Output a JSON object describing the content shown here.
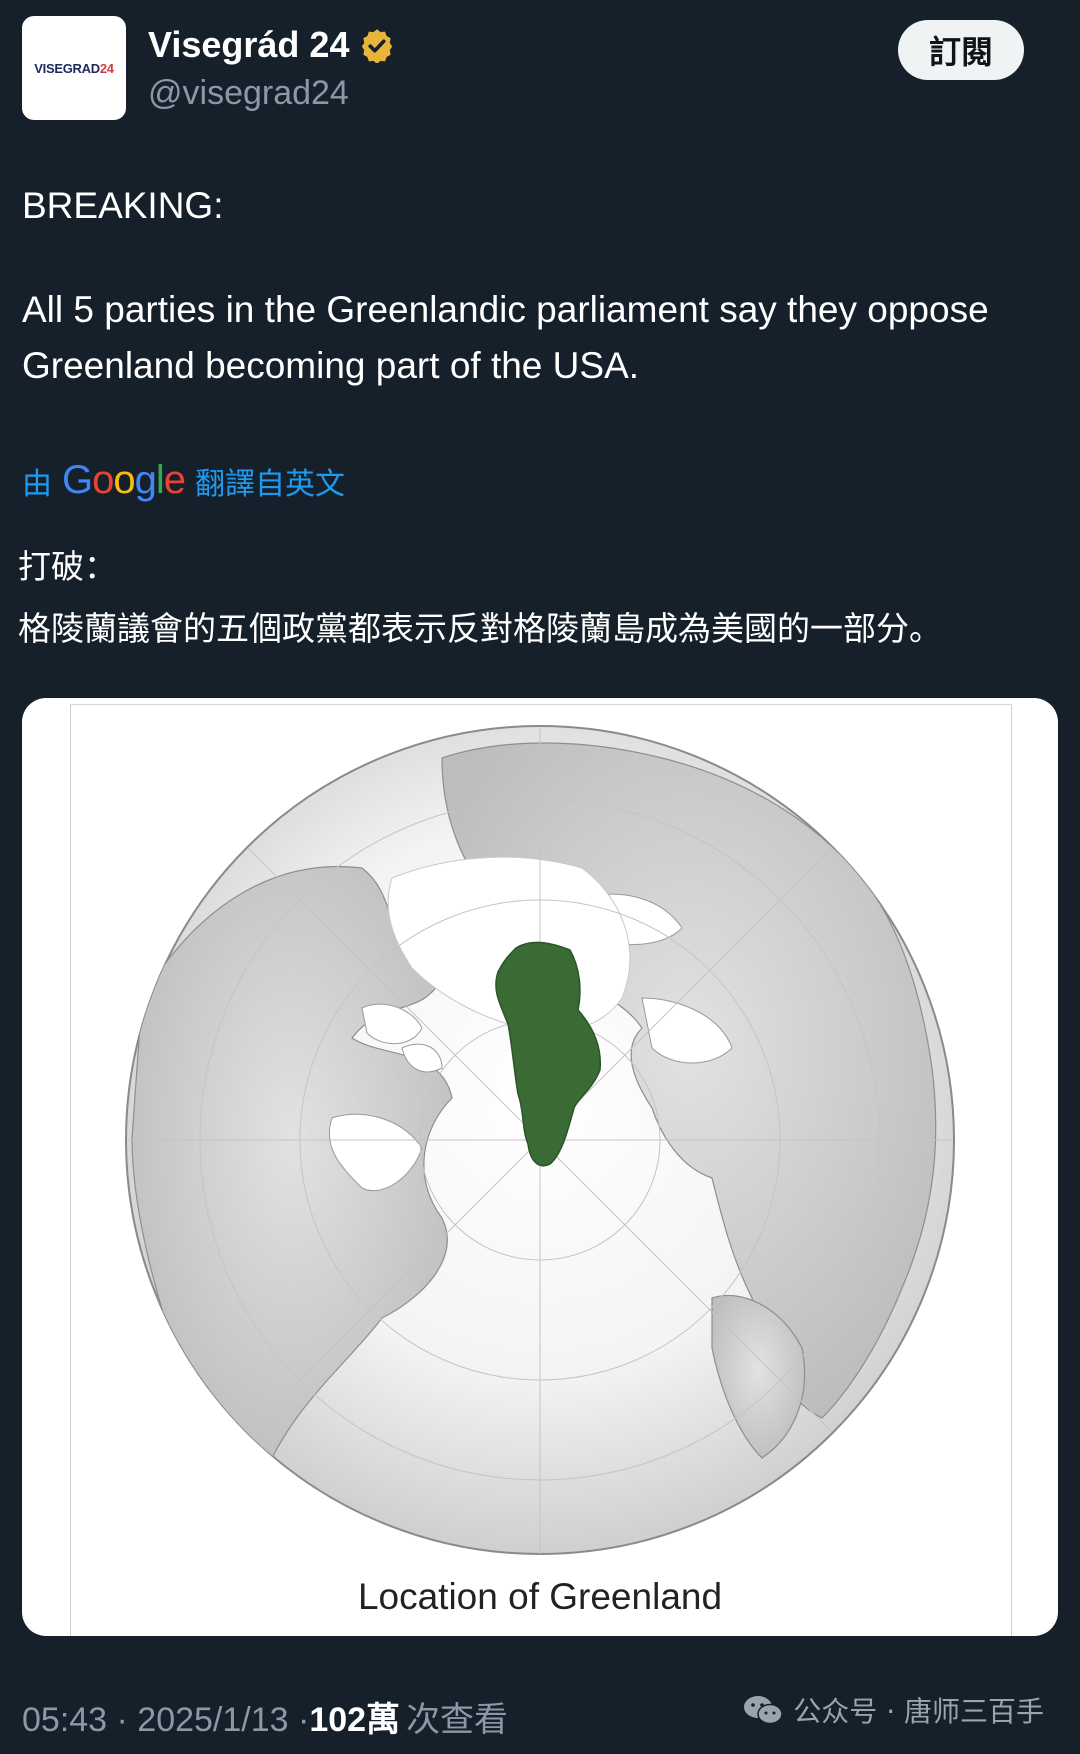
{
  "account": {
    "avatar_text_1": "VISEGRAD",
    "avatar_text_2": "24",
    "display_name": "Visegrád 24",
    "handle": "@visegrad24",
    "verified_badge": "gold-check-badge-icon"
  },
  "subscribe_label": "訂閱",
  "tweet": {
    "line1": "BREAKING:",
    "line2": "All 5 parties in the Greenlandic parliament say they oppose Greenland becoming part of the USA."
  },
  "translation": {
    "by": "由",
    "google": "Google",
    "from": "翻譯自英文",
    "line1": "打破：",
    "line2": "格陵蘭議會的五個政黨都表示反對格陵蘭島成為美國的一部分。"
  },
  "media": {
    "caption": "Location of Greenland",
    "highlight_color": "#3a6b35"
  },
  "meta": {
    "time_date": "05:43 · 2025/1/13 · ",
    "views": "102萬",
    "views_label": "次查看"
  },
  "watermark": {
    "icon": "wechat-icon",
    "text": "公众号 · 唐师三百手"
  }
}
